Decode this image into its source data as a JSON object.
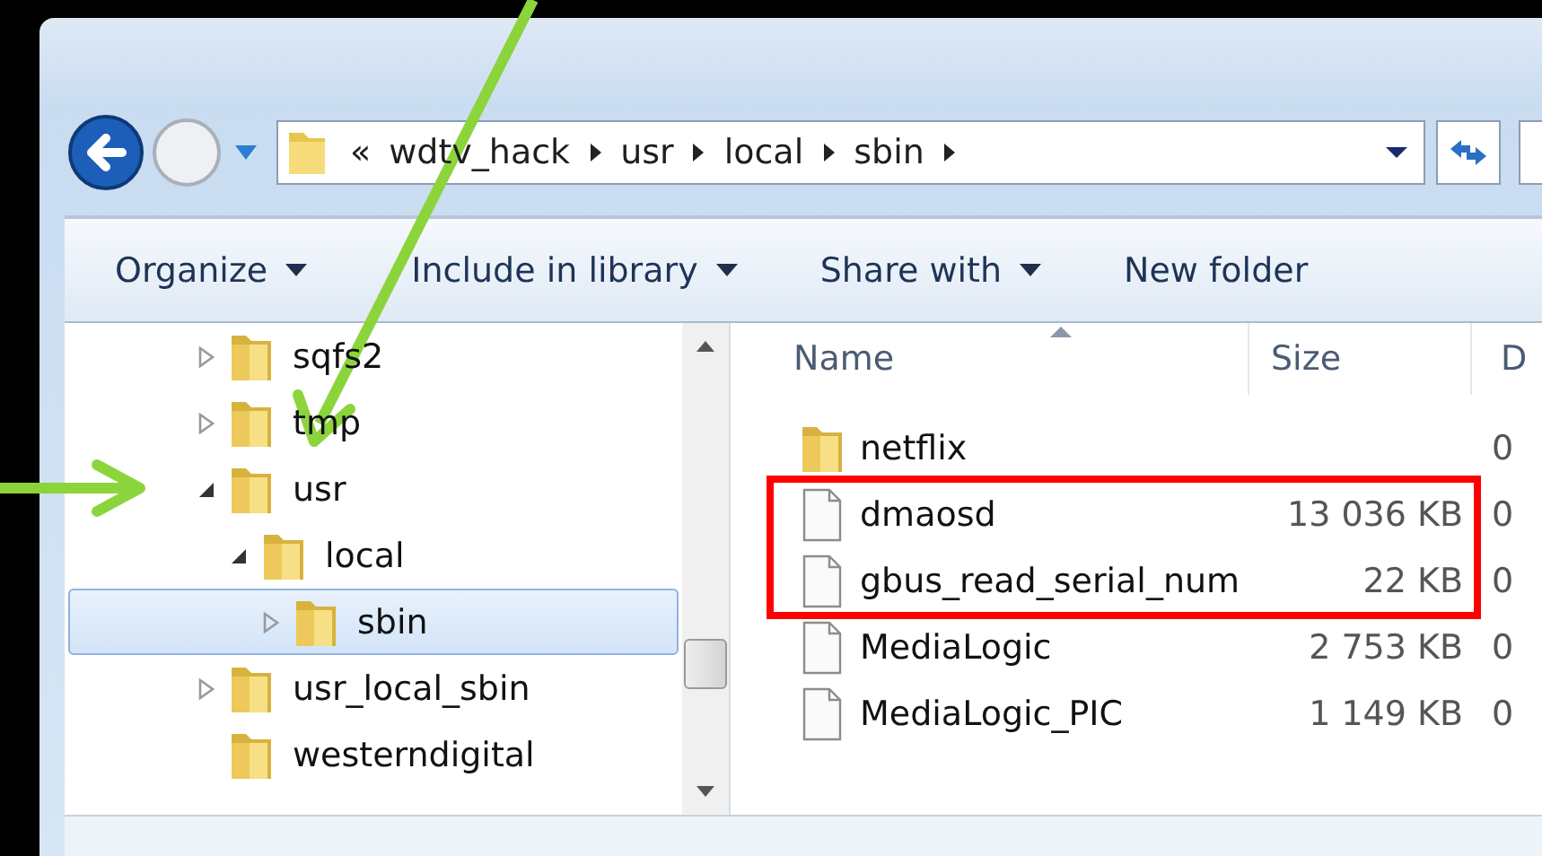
{
  "address_bar": {
    "separator": "«",
    "crumbs": [
      "wdtv_hack",
      "usr",
      "local",
      "sbin"
    ]
  },
  "toolbar": [
    {
      "label": "Organize",
      "dropdown": true
    },
    {
      "label": "Include in library",
      "dropdown": true
    },
    {
      "label": "Share with",
      "dropdown": true
    },
    {
      "label": "New folder",
      "dropdown": false
    }
  ],
  "navigation_tree": [
    {
      "label": "sqfs2",
      "expandable": true,
      "expanded": false,
      "selected": false
    },
    {
      "label": "tmp",
      "expandable": true,
      "expanded": false,
      "selected": false
    },
    {
      "label": "usr",
      "expandable": true,
      "expanded": true,
      "selected": false,
      "children": [
        {
          "label": "local",
          "expandable": true,
          "expanded": true,
          "selected": false,
          "children": [
            {
              "label": "sbin",
              "expandable": true,
              "expanded": false,
              "selected": true
            }
          ]
        }
      ]
    },
    {
      "label": "usr_local_sbin",
      "expandable": true,
      "expanded": false,
      "selected": false
    },
    {
      "label": "westerndigital",
      "expandable": false,
      "selected": false
    }
  ],
  "file_list": {
    "columns": [
      "Name",
      "Size",
      "D"
    ],
    "rows": [
      {
        "kind": "folder",
        "name": "netflix",
        "size": "",
        "column_3": "0",
        "highlighted": false
      },
      {
        "kind": "file",
        "name": "dmaosd",
        "size": "13 036 KB",
        "column_3": "0",
        "highlighted": true
      },
      {
        "kind": "file",
        "name": "gbus_read_serial_num",
        "size": "22 KB",
        "column_3": "0",
        "highlighted": true
      },
      {
        "kind": "file",
        "name": "MediaLogic",
        "size": "2 753 KB",
        "column_3": "0",
        "highlighted": false
      },
      {
        "kind": "file",
        "name": "MediaLogic_PIC",
        "size": "1 149 KB",
        "column_3": "0",
        "highlighted": false
      }
    ]
  }
}
